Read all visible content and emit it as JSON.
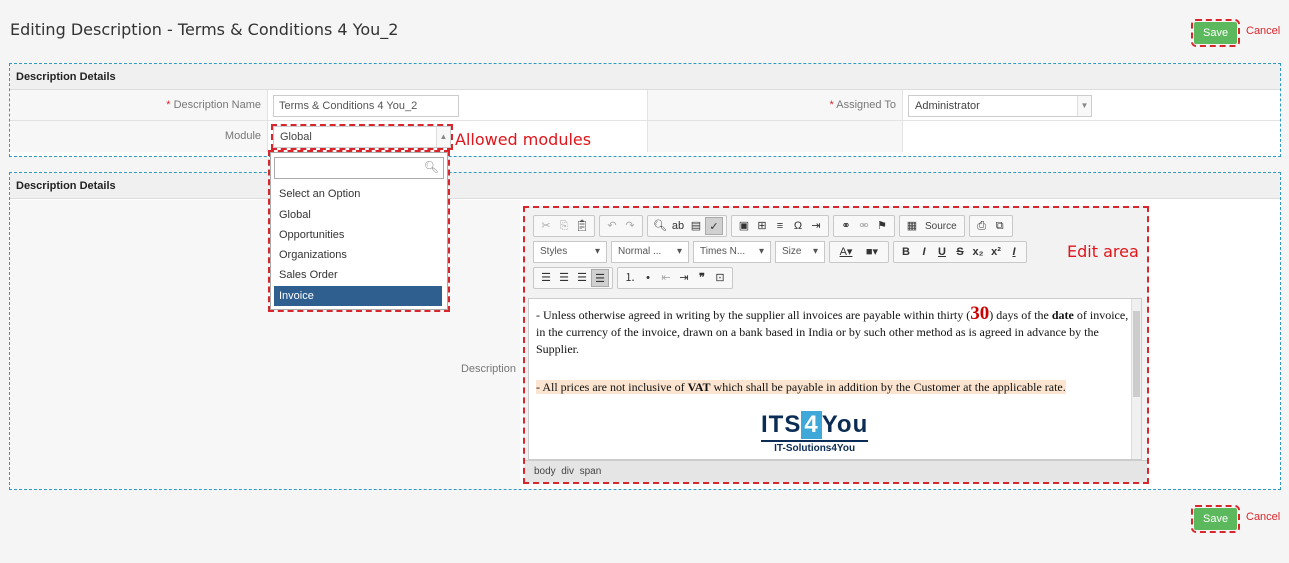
{
  "page": {
    "title": "Editing Description - Terms & Conditions 4 You_2",
    "save_label": "Save",
    "cancel_label": "Cancel"
  },
  "block1": {
    "header": "Description Details",
    "description_name_label": "Description Name",
    "description_name_value": "Terms & Conditions 4 You_2",
    "assigned_to_label": "Assigned To",
    "assigned_to_value": "Administrator",
    "module_label": "Module",
    "module_value": "Global",
    "required_mark": "*"
  },
  "dropdown": {
    "options": [
      "Select an Option",
      "Global",
      "Opportunities",
      "Organizations",
      "Sales Order",
      "Invoice"
    ],
    "selected": "Invoice"
  },
  "annotations": {
    "allowed_modules": "Allowed modules",
    "edit_area": "Edit area"
  },
  "block2": {
    "header": "Description Details",
    "description_label": "Description"
  },
  "editor": {
    "toolbar": {
      "source_label": "Source",
      "styles": "Styles",
      "format": "Normal ...",
      "font": "Times N...",
      "size": "Size"
    },
    "content": {
      "para1_pre": " - Unless otherwise agreed in writing by the supplier all invoices are payable within thirty (",
      "para1_num": "30",
      "para1_mid": ") days of the ",
      "para1_bold": "date",
      "para1_post": " of invoice, in the currency of the invoice, drawn on a bank based in India or by such other method as is agreed in advance by the Supplier.",
      "para2_pre": " - All prices are not inclusive of ",
      "para2_bold": "VAT",
      "para2_post": " which shall be payable in addition by the Customer at the applicable rate.",
      "logo_its": "ITS",
      "logo_4": "4",
      "logo_you": "You",
      "logo_sub": "IT-Solutions4You"
    },
    "status_path": "body  div  span"
  },
  "colors": {
    "save_green": "#5cb85c",
    "annotation_red": "#e0151b",
    "block_border_blue": "#2e9ac4",
    "selected_option": "#2f5f8f"
  }
}
